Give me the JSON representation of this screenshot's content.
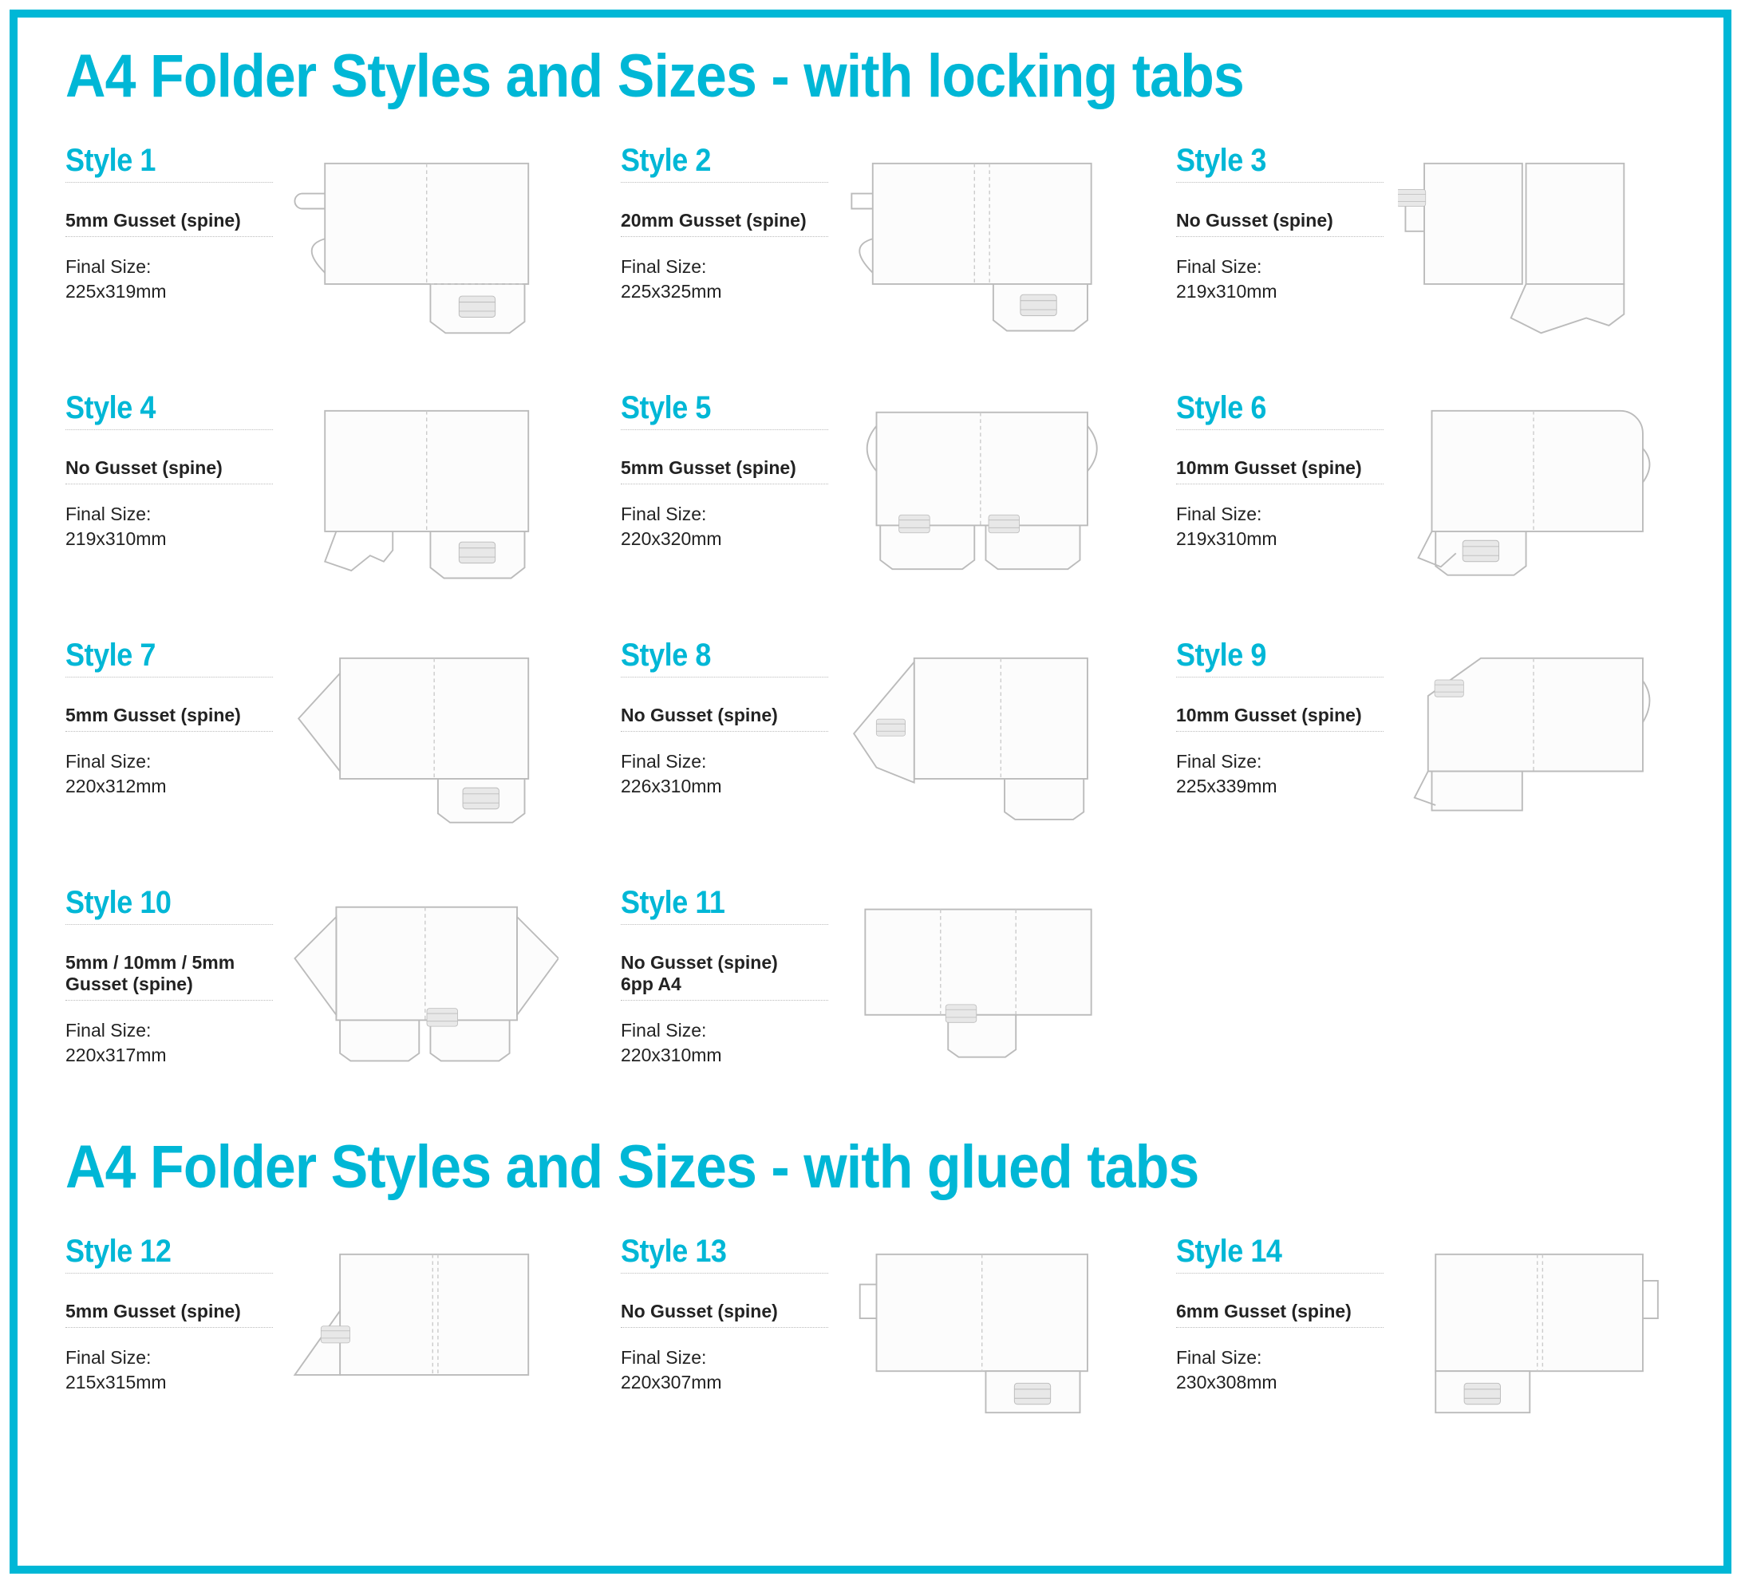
{
  "sections": [
    {
      "title": "A4 Folder Styles and Sizes - with locking tabs",
      "items": [
        {
          "name": "Style 1",
          "gusset": "5mm Gusset (spine)",
          "size": "Final Size:\n225x319mm",
          "dia": "s1"
        },
        {
          "name": "Style 2",
          "gusset": "20mm Gusset (spine)",
          "size": "Final Size:\n225x325mm",
          "dia": "s2"
        },
        {
          "name": "Style 3",
          "gusset": "No Gusset (spine)",
          "size": "Final Size:\n219x310mm",
          "dia": "s3"
        },
        {
          "name": "Style 4",
          "gusset": "No Gusset (spine)",
          "size": "Final Size:\n219x310mm",
          "dia": "s4"
        },
        {
          "name": "Style 5",
          "gusset": "5mm Gusset (spine)",
          "size": "Final Size:\n220x320mm",
          "dia": "s5"
        },
        {
          "name": "Style 6",
          "gusset": "10mm Gusset (spine)",
          "size": "Final Size:\n219x310mm",
          "dia": "s6"
        },
        {
          "name": "Style 7",
          "gusset": "5mm Gusset (spine)",
          "size": "Final Size:\n220x312mm",
          "dia": "s7"
        },
        {
          "name": "Style 8",
          "gusset": "No Gusset (spine)",
          "size": "Final Size:\n226x310mm",
          "dia": "s8"
        },
        {
          "name": "Style 9",
          "gusset": "10mm Gusset (spine)",
          "size": "Final Size:\n225x339mm",
          "dia": "s9"
        },
        {
          "name": "Style 10",
          "gusset": "5mm / 10mm / 5mm\nGusset (spine)",
          "size": "Final Size:\n220x317mm",
          "dia": "s10"
        },
        {
          "name": "Style 11",
          "gusset": "No Gusset (spine)\n6pp A4",
          "size": "Final Size:\n220x310mm",
          "dia": "s11"
        }
      ]
    },
    {
      "title": "A4 Folder Styles and Sizes - with glued tabs",
      "items": [
        {
          "name": "Style 12",
          "gusset": "5mm Gusset (spine)",
          "size": "Final Size:\n215x315mm",
          "dia": "s12"
        },
        {
          "name": "Style 13",
          "gusset": "No Gusset (spine)",
          "size": "Final Size:\n220x307mm",
          "dia": "s13"
        },
        {
          "name": "Style 14",
          "gusset": "6mm Gusset (spine)",
          "size": "Final Size:\n230x308mm",
          "dia": "s14"
        }
      ]
    }
  ]
}
